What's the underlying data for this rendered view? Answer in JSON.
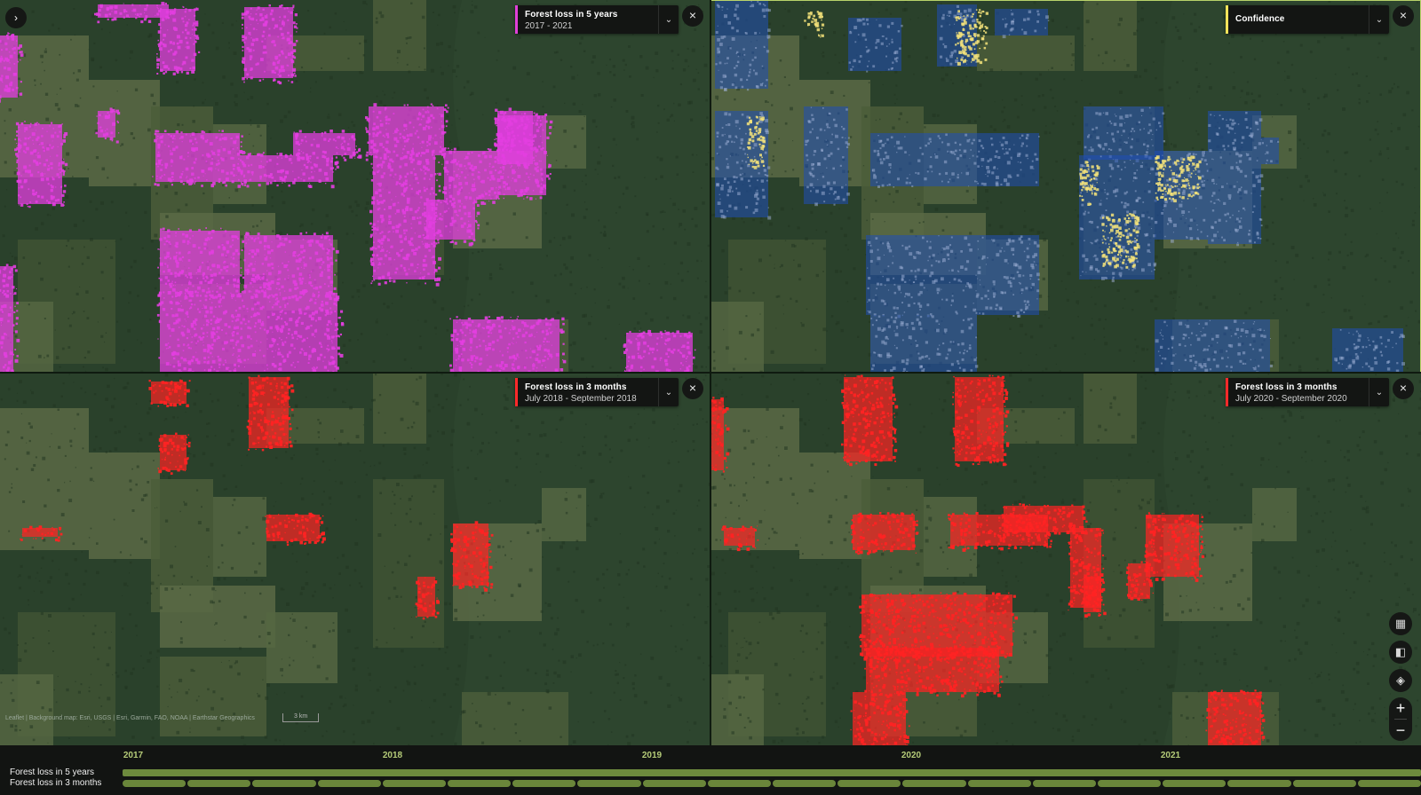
{
  "app": {
    "expand_icon": "chevron-right-icon"
  },
  "panels": [
    {
      "id": "p1",
      "layer_title": "Forest loss in 5 years",
      "layer_subtitle": "2017 - 2021",
      "swatch_color": "#e040d8",
      "overlay": "magenta",
      "active": false
    },
    {
      "id": "p2",
      "layer_title": "Confidence",
      "layer_subtitle": "",
      "swatch_color": "#f2e35a",
      "overlay": "confidence",
      "active": true
    },
    {
      "id": "p3",
      "layer_title": "Forest loss in 3 months",
      "layer_subtitle": "July 2018 - September 2018",
      "swatch_color": "#ff2a2a",
      "overlay": "red-2018",
      "active": false
    },
    {
      "id": "p4",
      "layer_title": "Forest loss in 3 months",
      "layer_subtitle": "July 2020 - September 2020",
      "swatch_color": "#ff2a2a",
      "overlay": "red-2020",
      "active": false
    }
  ],
  "icons": {
    "close": "×",
    "chevron_down": "⌄",
    "expand": "›"
  },
  "colors": {
    "magenta": "#e33ee0",
    "confidence_blue": "#1f4fb8",
    "confidence_yellow": "#f4e37a",
    "red": "#ff2323",
    "forest": "#2a412b",
    "timeline_accent": "#b5cc78"
  },
  "map_tools": {
    "grid_icon": "grid-view-icon",
    "compare_icon": "compare-view-icon",
    "layers_icon": "layers-icon",
    "zoom_in": "+",
    "zoom_out": "−"
  },
  "attribution": "Leaflet | Background map: Esri, USGS | Esri, Garmin, FAO, NOAA | Earthstar Geographics",
  "scale_label": "3 km",
  "timeline": {
    "years": [
      "2017",
      "2018",
      "2019",
      "2020",
      "2021"
    ],
    "rows": [
      "Forest loss in 5 years",
      "Forest loss in 3 months"
    ],
    "month_segments": 20
  }
}
